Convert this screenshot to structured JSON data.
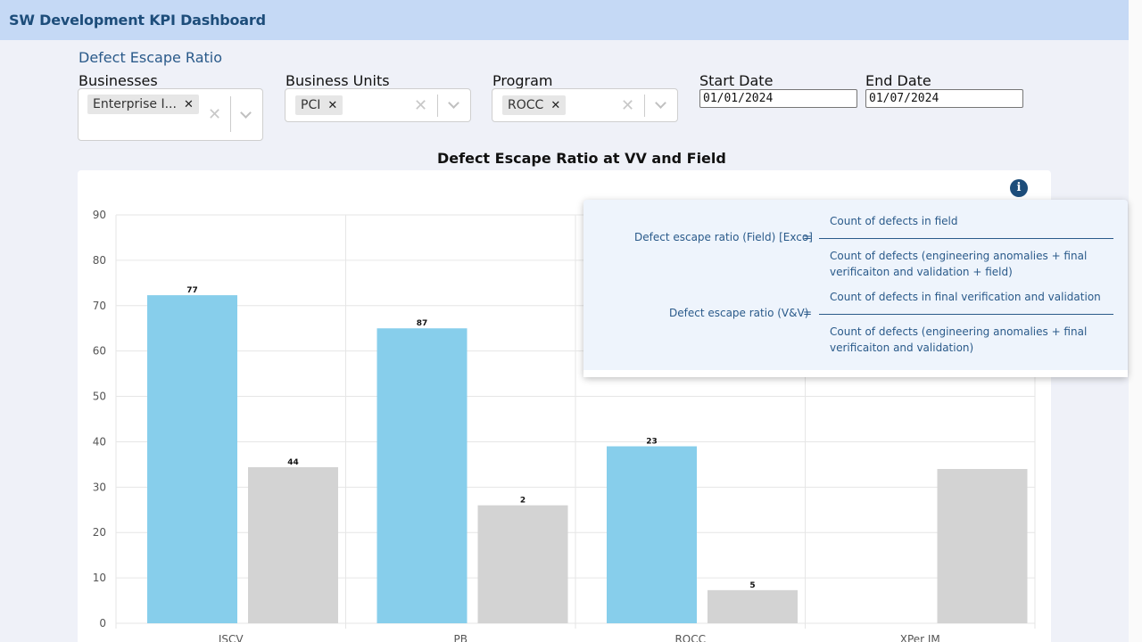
{
  "header": {
    "title": "SW Development KPI Dashboard"
  },
  "section": {
    "title": "Defect Escape Ratio"
  },
  "filters": {
    "businesses": {
      "label": "Businesses",
      "chips": [
        "Enterprise I..."
      ]
    },
    "business_units": {
      "label": "Business Units",
      "chips": [
        "PCI"
      ]
    },
    "program": {
      "label": "Program",
      "chips": [
        "ROCC"
      ]
    },
    "start_date": {
      "label": "Start Date",
      "value": "01/01/2024"
    },
    "end_date": {
      "label": "End Date",
      "value": "01/07/2024"
    }
  },
  "chart": {
    "title": "Defect Escape Ratio at VV and Field"
  },
  "tooltip": {
    "field_label": "Defect escape ratio (Field) [Exco]",
    "field_eq": "=",
    "field_num": "Count of defects in field",
    "field_den_1": "Count of defects (engineering anomalies + final",
    "field_den_2": "verificaiton and validation + field)",
    "vv_label": "Defect escape ratio (V&V)",
    "vv_eq": "=",
    "vv_num": "Count of defects in final verification and validation",
    "vv_den_1": "Count of defects (engineering anomalies + final",
    "vv_den_2": "verificaiton and validation)"
  },
  "icons": {
    "info": "info-icon",
    "clear": "clear-icon",
    "dropdown": "chevron-down-icon",
    "remove": "remove-chip-icon"
  },
  "colors": {
    "series_vv": "#87ceeb",
    "series_field": "#d3d3d3",
    "accent": "#1d4d7a"
  },
  "chart_data": {
    "type": "bar",
    "title": "Defect Escape Ratio at VV and Field",
    "categories": [
      "ISCV",
      "PB",
      "ROCC",
      "XPer IM"
    ],
    "ylim": [
      0,
      90
    ],
    "yticks": [
      0,
      10,
      20,
      30,
      40,
      50,
      60,
      70,
      80,
      90
    ],
    "grid": true,
    "series": [
      {
        "values": [
          72.3,
          65,
          39,
          null
        ],
        "labels": [
          "77",
          "87",
          "23",
          ""
        ],
        "color": "#87ceeb"
      },
      {
        "values": [
          34.4,
          26,
          7.3,
          34
        ],
        "labels": [
          "44",
          "2",
          "5",
          ""
        ],
        "color": "#d3d3d3"
      }
    ]
  }
}
